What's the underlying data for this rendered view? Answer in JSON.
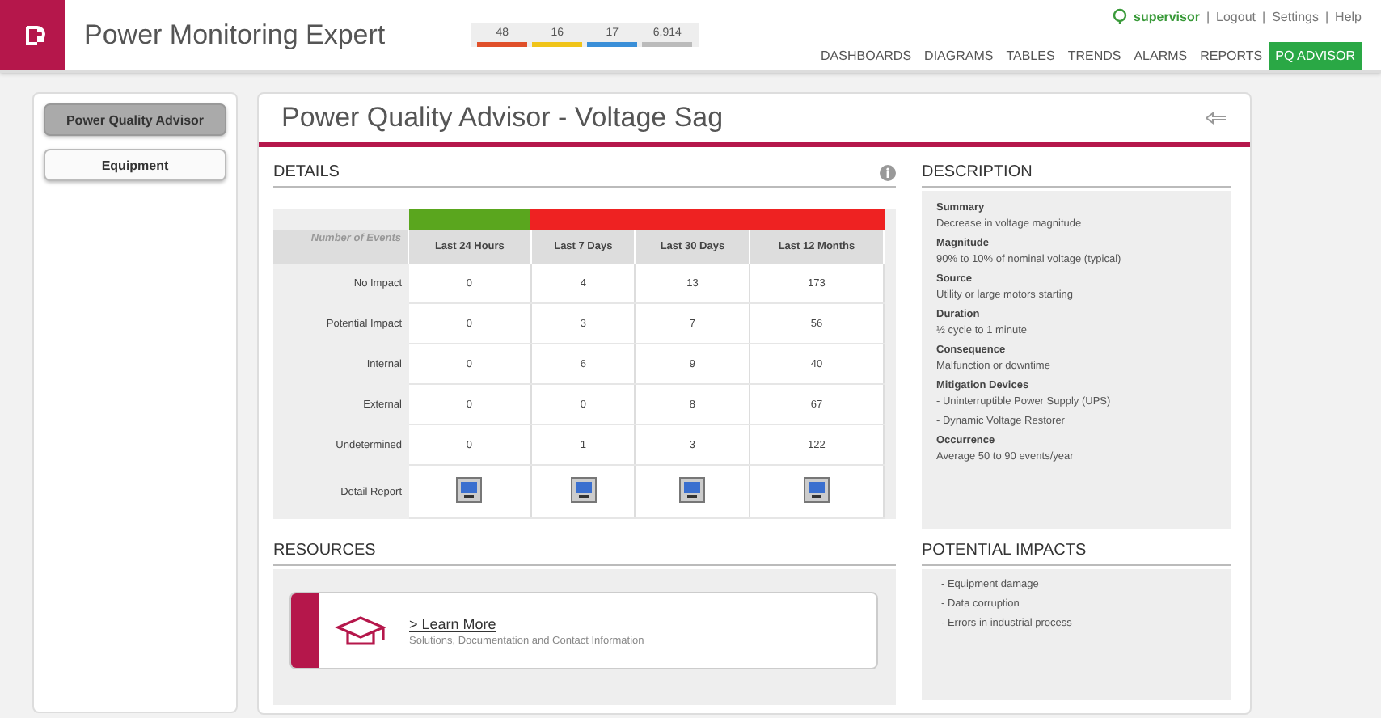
{
  "header": {
    "app_title": "Power Monitoring Expert",
    "alarm_counts": [
      {
        "count": "48",
        "color": "#e0502a"
      },
      {
        "count": "16",
        "color": "#f0c419"
      },
      {
        "count": "17",
        "color": "#3a8fd8"
      },
      {
        "count": "6,914",
        "color": "#bbbbbb"
      }
    ],
    "user": "supervisor",
    "separator": "|",
    "links": [
      "Logout",
      "Settings",
      "Help"
    ],
    "nav": [
      {
        "label": "DASHBOARDS",
        "selected": false
      },
      {
        "label": "DIAGRAMS",
        "selected": false
      },
      {
        "label": "TABLES",
        "selected": false
      },
      {
        "label": "TRENDS",
        "selected": false
      },
      {
        "label": "ALARMS",
        "selected": false
      },
      {
        "label": "REPORTS",
        "selected": false
      },
      {
        "label": "PQ ADVISOR",
        "selected": true
      }
    ]
  },
  "sidebar": {
    "items": [
      {
        "label": "Power Quality Advisor",
        "selected": true
      },
      {
        "label": "Equipment",
        "selected": false
      }
    ]
  },
  "page_title": "Power Quality Advisor - Voltage Sag",
  "details": {
    "title": "DETAILS",
    "corner": "Number of Events",
    "columns": [
      {
        "label": "Last 24 Hours",
        "color": "#5aa61e"
      },
      {
        "label": "Last 7 Days",
        "color": "#ee2222"
      },
      {
        "label": "Last 30 Days",
        "color": "#ee2222"
      },
      {
        "label": "Last 12 Months",
        "color": "#ee2222"
      }
    ],
    "rows": [
      {
        "label": "No Impact",
        "values": [
          "0",
          "4",
          "13",
          "173"
        ]
      },
      {
        "label": "Potential Impact",
        "values": [
          "0",
          "3",
          "7",
          "56"
        ]
      },
      {
        "label": "Internal",
        "values": [
          "0",
          "6",
          "9",
          "40"
        ]
      },
      {
        "label": "External",
        "values": [
          "0",
          "0",
          "8",
          "67"
        ]
      },
      {
        "label": "Undetermined",
        "values": [
          "0",
          "1",
          "3",
          "122"
        ]
      }
    ],
    "report_label": "Detail Report"
  },
  "description": {
    "title": "DESCRIPTION",
    "sections": [
      {
        "heading": "Summary",
        "lines": [
          "Decrease in voltage magnitude"
        ]
      },
      {
        "heading": "Magnitude",
        "lines": [
          "90% to 10% of nominal voltage (typical)"
        ]
      },
      {
        "heading": "Source",
        "lines": [
          "Utility or large motors starting"
        ]
      },
      {
        "heading": "Duration",
        "lines": [
          "½ cycle to 1 minute"
        ]
      },
      {
        "heading": "Consequence",
        "lines": [
          "Malfunction or downtime"
        ]
      },
      {
        "heading": "Mitigation Devices",
        "lines": [
          "- Uninterruptible Power Supply (UPS)",
          "- Dynamic Voltage Restorer"
        ]
      },
      {
        "heading": "Occurrence",
        "lines": [
          "Average 50 to 90 events/year"
        ]
      }
    ]
  },
  "resources": {
    "title": "RESOURCES",
    "link": "> Learn More",
    "subtitle": "Solutions, Documentation and Contact Information"
  },
  "potential_impacts": {
    "title": "POTENTIAL IMPACTS",
    "items": [
      "- Equipment damage",
      "- Data corruption",
      "- Errors in industrial process"
    ]
  }
}
